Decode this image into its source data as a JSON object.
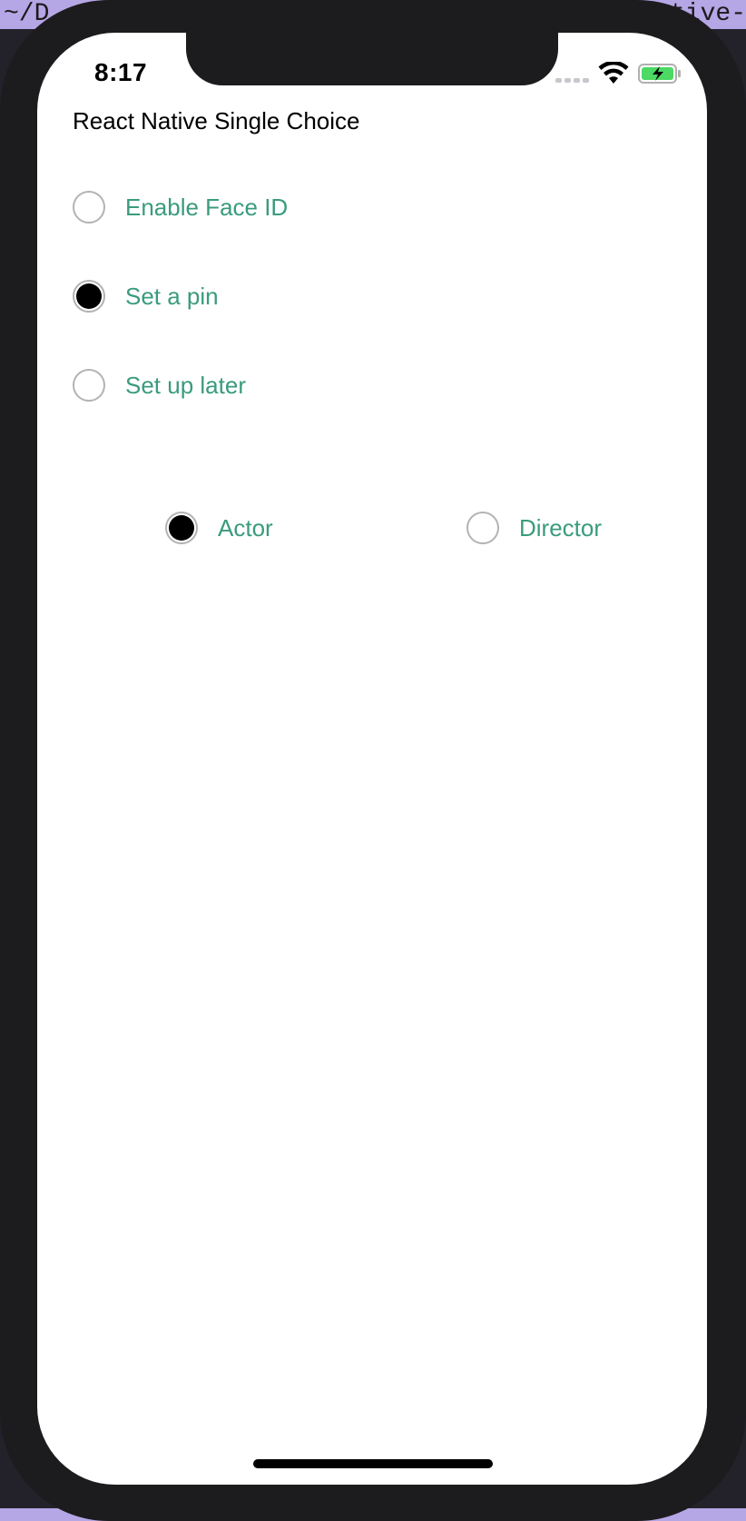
{
  "background": {
    "title_left": "~/D",
    "title_right": "tive-"
  },
  "status_bar": {
    "time": "8:17"
  },
  "app": {
    "title": "React Native Single Choice",
    "vertical_group": [
      {
        "label": "Enable Face ID",
        "selected": false
      },
      {
        "label": "Set a pin",
        "selected": true
      },
      {
        "label": "Set up later",
        "selected": false
      }
    ],
    "horizontal_group": [
      {
        "label": "Actor",
        "selected": true
      },
      {
        "label": "Director",
        "selected": false
      }
    ]
  },
  "colors": {
    "label_green": "#3a9b7d",
    "radio_border": "#b3b3b3",
    "radio_selected": "#000000",
    "battery_green": "#4cd964"
  },
  "icons": {
    "wifi": "wifi-icon",
    "battery": "battery-charging-icon",
    "signal": "cellular-signal-icon"
  }
}
